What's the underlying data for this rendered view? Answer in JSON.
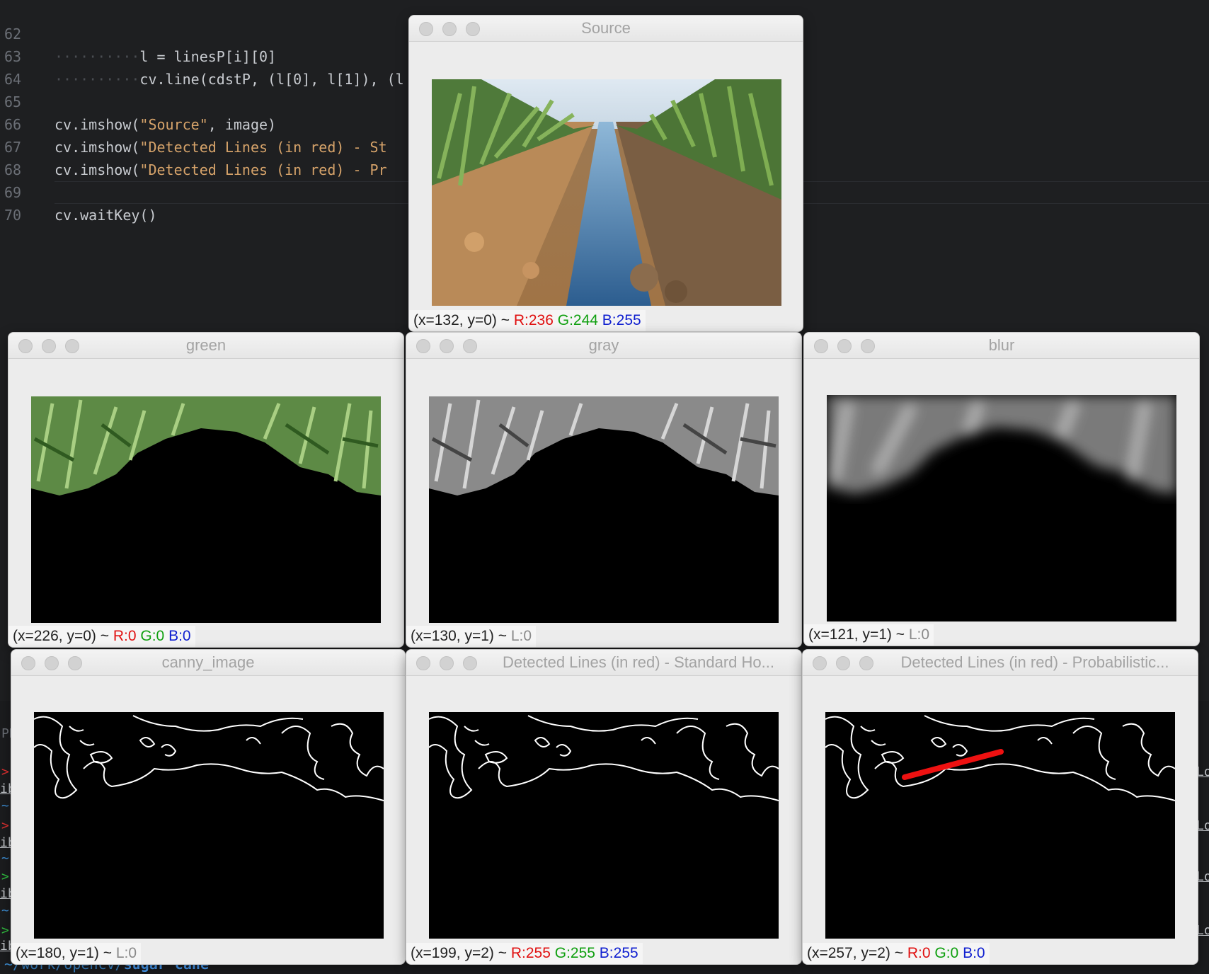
{
  "editor": {
    "lines": [
      {
        "num": "62",
        "code": "l = linesP[i][0]"
      },
      {
        "num": "63",
        "code": "cv.line(cdstP, (l[0], l[1]), (l"
      },
      {
        "num": "64",
        "code": ""
      },
      {
        "num": "65",
        "code_pre": "cv.imshow(",
        "code_str": "\"Source\"",
        "code_post": ", image)"
      },
      {
        "num": "66",
        "code_pre": "cv.imshow(",
        "code_str": "\"Detected Lines (in red) - St",
        "code_post": ""
      },
      {
        "num": "67",
        "code_pre": "cv.imshow(",
        "code_str": "\"Detected Lines (in red) - Pr",
        "code_post": ""
      },
      {
        "num": "68",
        "code": ""
      },
      {
        "num": "69",
        "code": "cv.waitKey()"
      },
      {
        "num": "70",
        "code": ""
      }
    ]
  },
  "terminal": {
    "path": "~/work/opencv/",
    "path_bold": "sugar cane",
    "left_fragments": [
      "PR",
      ">",
      "ib",
      "~",
      ">",
      "ib",
      "~",
      ">",
      "ib",
      "~",
      ">",
      "ib"
    ],
    "right_fragments": [
      "Lo",
      "Lo",
      "Lo",
      "Lo"
    ]
  },
  "windows": [
    {
      "id": "source",
      "title": "Source",
      "status_pos": "(x=132, y=0) ~ ",
      "status_r": "R:236",
      "status_g": "G:244",
      "status_b": "B:255"
    },
    {
      "id": "green",
      "title": "green",
      "status_pos": "(x=226, y=0) ~ ",
      "status_r": "R:0",
      "status_g": "G:0",
      "status_b": "B:0"
    },
    {
      "id": "gray",
      "title": "gray",
      "status_pos": "(x=130, y=1) ~ ",
      "status_l": "L:0"
    },
    {
      "id": "blur",
      "title": "blur",
      "status_pos": "(x=121, y=1) ~ ",
      "status_l": "L:0"
    },
    {
      "id": "canny",
      "title": "canny_image",
      "status_pos": "(x=180, y=1) ~ ",
      "status_l": "L:0"
    },
    {
      "id": "standard",
      "title": "Detected Lines (in red) - Standard Ho...",
      "status_pos": "(x=199, y=2) ~ ",
      "status_r": "R:255",
      "status_g": "G:255",
      "status_b": "B:255"
    },
    {
      "id": "prob",
      "title": "Detected Lines (in red) - Probabilistic...",
      "status_pos": "(x=257, y=2) ~ ",
      "status_r": "R:0",
      "status_g": "G:0",
      "status_b": "B:0"
    }
  ]
}
